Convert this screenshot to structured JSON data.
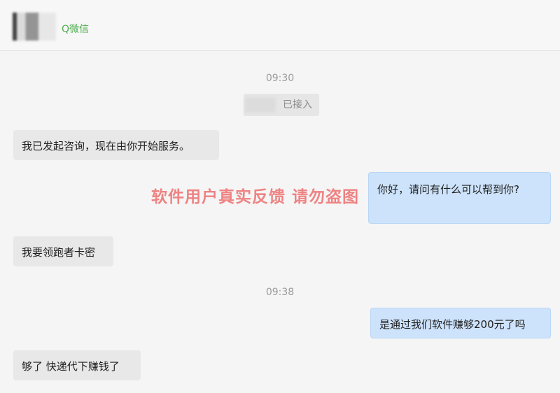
{
  "header": {
    "channel_label": "Q微信"
  },
  "conversation": {
    "time1": "09:30",
    "system_notice": "已接入",
    "msg1": "我已发起咨询，现在由你开始服务。",
    "msg2": "你好，请问有什么可以帮到你?",
    "msg3": "我要领跑者卡密",
    "time2": "09:38",
    "msg4": "是通过我们软件赚够200元了吗",
    "msg5": "够了 快递代下赚钱了"
  },
  "watermark": "软件用户真实反馈  请勿盗图",
  "colors": {
    "background": "#f5f5f5",
    "incoming_bubble": "#e8e8e8",
    "outgoing_bubble": "#cde3fb",
    "watermark": "#ef6f6f",
    "channel_green": "#4cae4c"
  }
}
